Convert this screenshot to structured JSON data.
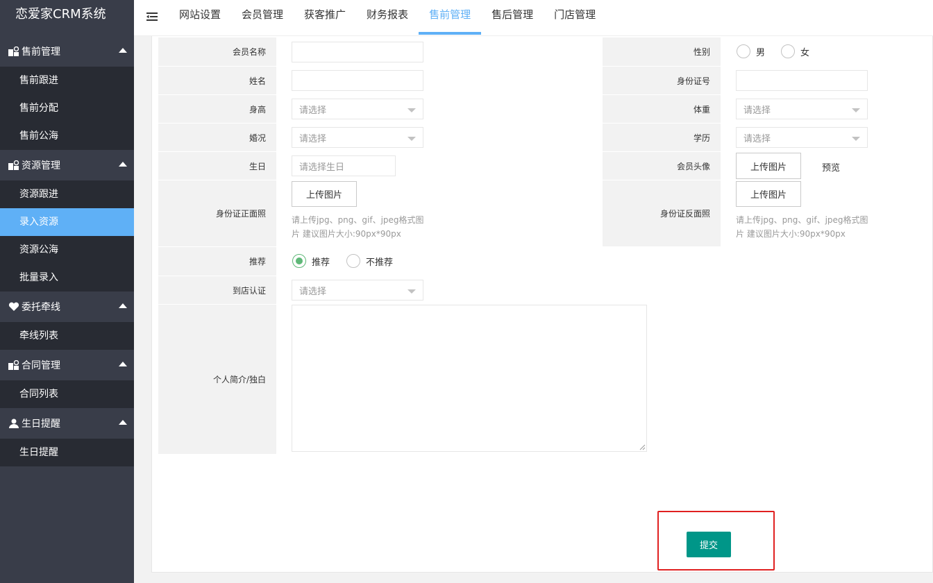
{
  "app": {
    "title": "恋爱家CRM系统"
  },
  "sidebar": {
    "groups": [
      {
        "label": "售前管理",
        "icon": "modules-icon",
        "items": [
          {
            "label": "售前跟进"
          },
          {
            "label": "售前分配"
          },
          {
            "label": "售前公海"
          }
        ]
      },
      {
        "label": "资源管理",
        "icon": "modules-icon",
        "items": [
          {
            "label": "资源跟进"
          },
          {
            "label": "录入资源",
            "active": true
          },
          {
            "label": "资源公海"
          },
          {
            "label": "批量录入"
          }
        ]
      },
      {
        "label": "委托牵线",
        "icon": "heart-icon",
        "items": [
          {
            "label": "牵线列表"
          }
        ]
      },
      {
        "label": "合同管理",
        "icon": "modules-icon",
        "items": [
          {
            "label": "合同列表"
          }
        ]
      },
      {
        "label": "生日提醒",
        "icon": "user-icon",
        "items": [
          {
            "label": "生日提醒"
          }
        ]
      }
    ]
  },
  "topnav": {
    "items": [
      {
        "label": "网站设置"
      },
      {
        "label": "会员管理"
      },
      {
        "label": "获客推广"
      },
      {
        "label": "财务报表"
      },
      {
        "label": "售前管理",
        "active": true
      },
      {
        "label": "售后管理"
      },
      {
        "label": "门店管理"
      }
    ]
  },
  "form": {
    "member_name": {
      "label": "会员名称",
      "value": ""
    },
    "gender": {
      "label": "性别",
      "options": [
        "男",
        "女"
      ]
    },
    "name": {
      "label": "姓名",
      "value": ""
    },
    "id_number": {
      "label": "身份证号",
      "value": ""
    },
    "height": {
      "label": "身高",
      "placeholder": "请选择"
    },
    "weight": {
      "label": "体重",
      "placeholder": "请选择"
    },
    "marital": {
      "label": "婚况",
      "placeholder": "请选择"
    },
    "education": {
      "label": "学历",
      "placeholder": "请选择"
    },
    "birthday": {
      "label": "生日",
      "placeholder": "请选择生日"
    },
    "avatar": {
      "label": "会员头像",
      "button": "上传图片",
      "preview": "预览"
    },
    "id_front": {
      "label": "身份证正面照",
      "button": "上传图片",
      "hint_line1": "请上传jpg、png、gif、jpeg格式图",
      "hint_line2": "片 建议图片大小:90px*90px"
    },
    "id_back": {
      "label": "身份证反面照",
      "button": "上传图片",
      "hint_line1": "请上传jpg、png、gif、jpeg格式图",
      "hint_line2": "片 建议图片大小:90px*90px"
    },
    "recommend": {
      "label": "推荐",
      "options": [
        "推荐",
        "不推荐"
      ],
      "selected": "推荐"
    },
    "store_verify": {
      "label": "到店认证",
      "placeholder": "请选择"
    },
    "bio": {
      "label": "个人简介/独白",
      "value": ""
    },
    "submit": "提交"
  },
  "colors": {
    "sidebar_bg": "#393d49",
    "submenu_bg": "#282b33",
    "active_blue": "#5fb0f6",
    "submit_green": "#009688",
    "radio_green": "#5FB878",
    "highlight_red": "#e02020"
  }
}
